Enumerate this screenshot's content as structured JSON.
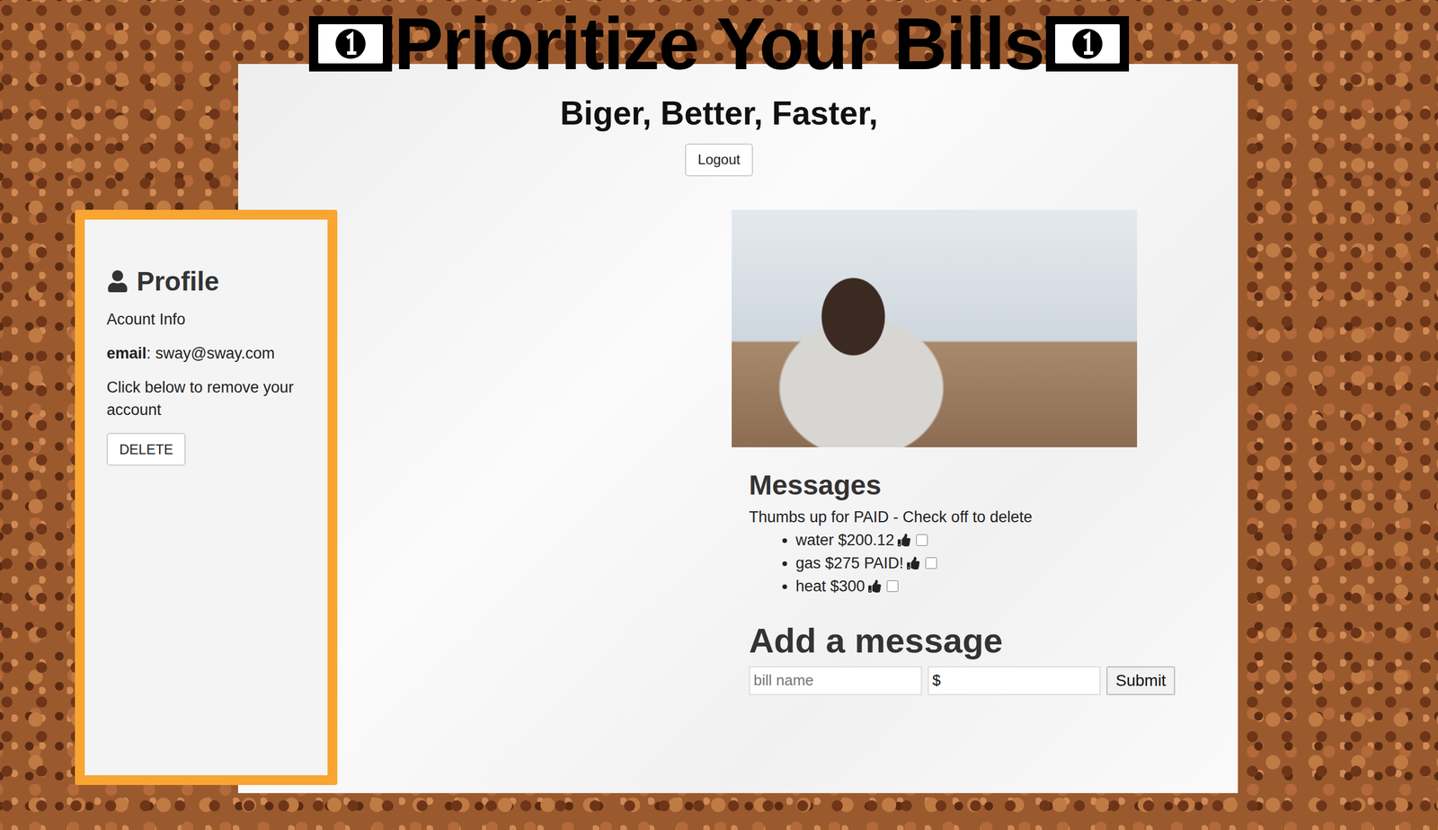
{
  "header": {
    "title": "Prioritize Your Bills",
    "subtitle": "Biger, Better, Faster,",
    "logout": "Logout"
  },
  "profile": {
    "title": "Profile",
    "section": "Acount Info",
    "email_label": "email",
    "email_sep": ":",
    "email_value": "sway@sway.com",
    "remove_text": "Click below to remove your account",
    "delete_button": "DELETE"
  },
  "messages": {
    "title": "Messages",
    "hint": "Thumbs up for PAID - Check off to delete",
    "items": [
      {
        "text": "water $200.12",
        "checked": false
      },
      {
        "text": "gas $275 PAID!",
        "checked": false
      },
      {
        "text": "heat $300",
        "checked": false
      }
    ]
  },
  "add_message": {
    "title": "Add a message",
    "fields": [
      {
        "name": "bill-name",
        "placeholder": "bill name",
        "value": ""
      },
      {
        "name": "amount",
        "placeholder": "",
        "value": "$"
      }
    ],
    "submit": "Submit"
  }
}
